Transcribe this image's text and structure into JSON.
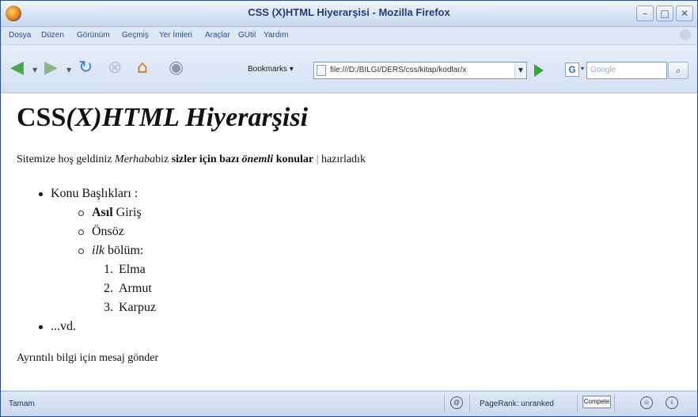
{
  "window": {
    "title": "CSS (X)HTML Hiyerarşisi - Mozilla Firefox",
    "buttons": {
      "minimize": "–",
      "maximize": "□",
      "close": "✕"
    }
  },
  "menu": [
    "Dosya",
    "Düzen",
    "Görünüm",
    "Geçmiş",
    "Yer İmleri",
    "Araçlar",
    "GUtil",
    "Yardım"
  ],
  "toolbar": {
    "bookmarks_label": "Bookmarks",
    "url": "file:///D:/BILGI/DERS/css/kitap/kodlar/x",
    "search_placeholder": "Google",
    "search_engine_letter": "G"
  },
  "page": {
    "heading_normal": "CSS",
    "heading_italic": "(X)HTML Hiyerarşisi",
    "intro": {
      "t1": "Sitemize hoş geldiniz ",
      "t2_italic": "Merhaba",
      "t3": "biz ",
      "t4_bold": "sizler için bazı ",
      "t5_bolditalic": "önemli",
      "t6_bold": " konular",
      "t7_sep": " | ",
      "t8": "hazırladık"
    },
    "list": {
      "item1": "Konu Başlıkları :",
      "sub1_bold": "Asıl",
      "sub1_rest": " Giriş",
      "sub2": "Önsöz",
      "sub3_italic": "ilk",
      "sub3_rest": " bölüm:",
      "ordered": [
        {
          "n": "1.",
          "label": "Elma"
        },
        {
          "n": "2.",
          "label": "Armut"
        },
        {
          "n": "3.",
          "label": "Karpuz"
        }
      ],
      "item2": "...vd."
    },
    "footer": "Ayrıntılı bilgi için mesaj gönder"
  },
  "status": {
    "text": "Tamam",
    "pagerank": "PageRank: unranked",
    "compete": "Compete"
  }
}
